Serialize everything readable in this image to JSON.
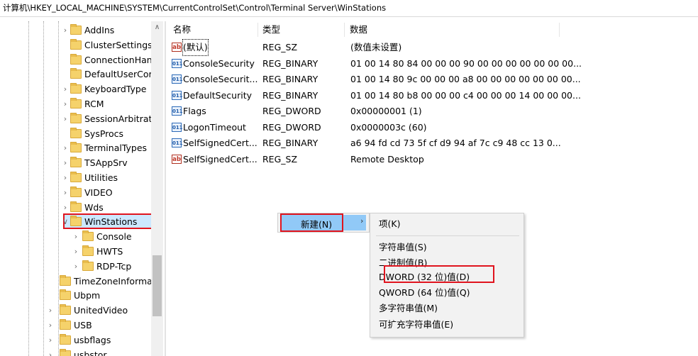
{
  "address_path": "计算机\\HKEY_LOCAL_MACHINE\\SYSTEM\\CurrentControlSet\\Control\\Terminal Server\\WinStations",
  "tree": {
    "items": [
      {
        "label": "AddIns",
        "expander": "›",
        "level": 3
      },
      {
        "label": "ClusterSettings",
        "expander": "",
        "level": 3
      },
      {
        "label": "ConnectionHan",
        "expander": "",
        "level": 3
      },
      {
        "label": "DefaultUserCor",
        "expander": "",
        "level": 3
      },
      {
        "label": "KeyboardType",
        "expander": "›",
        "level": 3
      },
      {
        "label": "RCM",
        "expander": "›",
        "level": 3
      },
      {
        "label": "SessionArbitrat",
        "expander": "›",
        "level": 3
      },
      {
        "label": "SysProcs",
        "expander": "",
        "level": 3
      },
      {
        "label": "TerminalTypes",
        "expander": "›",
        "level": 3
      },
      {
        "label": "TSAppSrv",
        "expander": "›",
        "level": 3
      },
      {
        "label": "Utilities",
        "expander": "›",
        "level": 3
      },
      {
        "label": "VIDEO",
        "expander": "›",
        "level": 3
      },
      {
        "label": "Wds",
        "expander": "›",
        "level": 3
      },
      {
        "label": "WinStations",
        "expander": "∨",
        "level": 3,
        "selected": true
      },
      {
        "label": "Console",
        "expander": "›",
        "level": 4
      },
      {
        "label": "HWTS",
        "expander": "›",
        "level": 4
      },
      {
        "label": "RDP-Tcp",
        "expander": "›",
        "level": 4
      },
      {
        "label": "TimeZoneInformat",
        "expander": "",
        "level": 2
      },
      {
        "label": "Ubpm",
        "expander": "",
        "level": 2
      },
      {
        "label": "UnitedVideo",
        "expander": "›",
        "level": 2
      },
      {
        "label": "USB",
        "expander": "›",
        "level": 2
      },
      {
        "label": "usbflags",
        "expander": "›",
        "level": 2
      },
      {
        "label": "usbstor",
        "expander": "›",
        "level": 2
      }
    ],
    "scroll_up_glyph": "∧"
  },
  "values": {
    "headers": {
      "name": "名称",
      "type": "类型",
      "data": "数据"
    },
    "rows": [
      {
        "icon": "string-value-icon",
        "icon_glyph": "ab",
        "name": "(默认)",
        "type": "REG_SZ",
        "data": "(数值未设置)",
        "focused": true
      },
      {
        "icon": "binary-value-icon",
        "icon_glyph": "011",
        "name": "ConsoleSecurity",
        "type": "REG_BINARY",
        "data": "01 00 14 80 84 00 00 00 90 00 00 00 00 00 00 00..."
      },
      {
        "icon": "binary-value-icon",
        "icon_glyph": "011",
        "name": "ConsoleSecurit...",
        "type": "REG_BINARY",
        "data": "01 00 14 80 9c 00 00 00 a8 00 00 00 00 00 00 00..."
      },
      {
        "icon": "binary-value-icon",
        "icon_glyph": "011",
        "name": "DefaultSecurity",
        "type": "REG_BINARY",
        "data": "01 00 14 80 b8 00 00 00 c4 00 00 00 14 00 00 00..."
      },
      {
        "icon": "binary-value-icon",
        "icon_glyph": "011",
        "name": "Flags",
        "type": "REG_DWORD",
        "data": "0x00000001 (1)"
      },
      {
        "icon": "binary-value-icon",
        "icon_glyph": "011",
        "name": "LogonTimeout",
        "type": "REG_DWORD",
        "data": "0x0000003c (60)"
      },
      {
        "icon": "binary-value-icon",
        "icon_glyph": "011",
        "name": "SelfSignedCert...",
        "type": "REG_BINARY",
        "data": "a6 94 fd cd 73 5f cf d9 94 af 7c c9 48 cc 13 0..."
      },
      {
        "icon": "string-value-icon",
        "icon_glyph": "ab",
        "name": "SelfSignedCert...",
        "type": "REG_SZ",
        "data": "Remote Desktop"
      }
    ]
  },
  "context_menu": {
    "new_label": "新建(N)",
    "submenu_arrow": "›",
    "submenu": [
      {
        "label": "项(K)"
      },
      {
        "label": "字符串值(S)"
      },
      {
        "label": "二进制值(B)"
      },
      {
        "label": "DWORD (32 位)值(D)",
        "highlighted": true
      },
      {
        "label": "QWORD (64 位)值(Q)"
      },
      {
        "label": "多字符串值(M)"
      },
      {
        "label": "可扩充字符串值(E)"
      }
    ]
  },
  "colors": {
    "highlight_box": "#e0141e",
    "menu_hover": "#91c9f7",
    "selection": "#cce8ff",
    "folder": "#f5d26b"
  }
}
